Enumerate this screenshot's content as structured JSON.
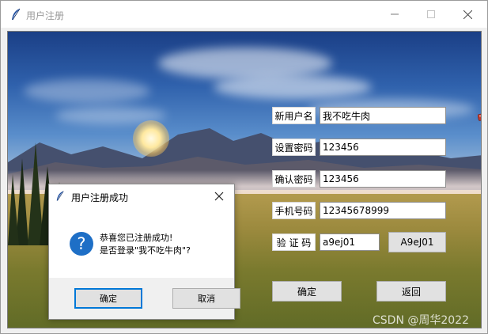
{
  "window": {
    "title": "用户注册",
    "icon": "feather-icon",
    "controls": [
      "minimize-icon",
      "maximize-icon",
      "close-icon"
    ]
  },
  "form": {
    "username_label": "新用户名",
    "username_value": "我不吃牛肉",
    "password_label": "设置密码",
    "password_value": "123456",
    "confirm_label": "确认密码",
    "confirm_value": "123456",
    "phone_label": "手机号码",
    "phone_value": "12345678999",
    "captcha_label": "验 证 码",
    "captcha_value": "a9ej01",
    "captcha_code": "A9eJ01",
    "confirm_button": "确定",
    "back_button": "返回"
  },
  "dialog": {
    "title": "用户注册成功",
    "message_line1": "恭喜您已注册成功!",
    "message_line2": "是否登录\"我不吃牛肉\"?",
    "ok_button": "确定",
    "cancel_button": "取消"
  },
  "watermark": "CSDN @周华2022",
  "colors": {
    "dialog_ok_border": "#0078d7",
    "question_icon": "#1e6fc6"
  }
}
